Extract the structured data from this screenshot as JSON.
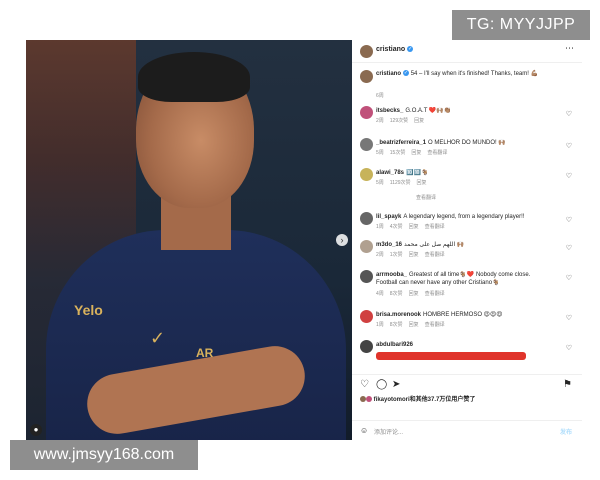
{
  "watermarks": {
    "top": "TG: MYYJJPP",
    "bottom": "www.jmsyy168.com"
  },
  "photo": {
    "shirt_text": "Yelo",
    "shirt_brand": "AR"
  },
  "header": {
    "username": "cristiano",
    "more_icon": "more-horizontal-icon"
  },
  "caption": {
    "username": "cristiano",
    "text": "54 – I'll say when it's finished! Thanks, team! 💪🏽",
    "time": "6周"
  },
  "comments": [
    {
      "user": "itsbecks_",
      "text": "G.O.A.T ❤️🙌🏽👏🏽",
      "time": "2周",
      "likes": "129次赞",
      "reply": "回复",
      "replies": ""
    },
    {
      "user": "_beatrizferreira_1",
      "text": "O MELHOR DO MUNDO! 🙌🏽",
      "time": "5周",
      "likes": "15次赞",
      "reply": "回复",
      "replies": "查看翻译"
    },
    {
      "user": "alawi_78s",
      "text": "🔟🔟🐐",
      "time": "5周",
      "likes": "1129次赞",
      "reply": "回复",
      "replies": "查看翻译"
    },
    {
      "user": "lil_spayk",
      "text": "A legendary legend, from a legendary player!!",
      "time": "1周",
      "likes": "4次赞",
      "reply": "回复",
      "replies": "查看翻译"
    },
    {
      "user": "m3do_16",
      "text": "اللهم صل على محمد 🙌🏽",
      "time": "2周",
      "likes": "1次赞",
      "reply": "回复",
      "replies": "查看翻译"
    },
    {
      "user": "arrmooba_",
      "text": "Greatest of all time🐐❤️ Nobody come close. Football can never have any other Cristiano🐐",
      "time": "4周",
      "likes": "8次赞",
      "reply": "回复",
      "replies": "查看翻译"
    },
    {
      "user": "brisa.morenook",
      "text": "HOMBRE HERMOSO 😍😍😍",
      "time": "1周",
      "likes": "8次赞",
      "reply": "回复",
      "replies": "查看翻译"
    },
    {
      "user": "abdulbari926",
      "text": "",
      "time": "",
      "likes": "",
      "reply": "",
      "replies": ""
    }
  ],
  "likes_line": "fikayotomori和其他37.7万位用户赞了",
  "add_comment": {
    "placeholder": "添加评论...",
    "post_label": "发布"
  },
  "icons": [
    "heart-icon",
    "comment-icon",
    "share-icon",
    "bookmark-icon",
    "emoji-icon",
    "verified-icon"
  ]
}
